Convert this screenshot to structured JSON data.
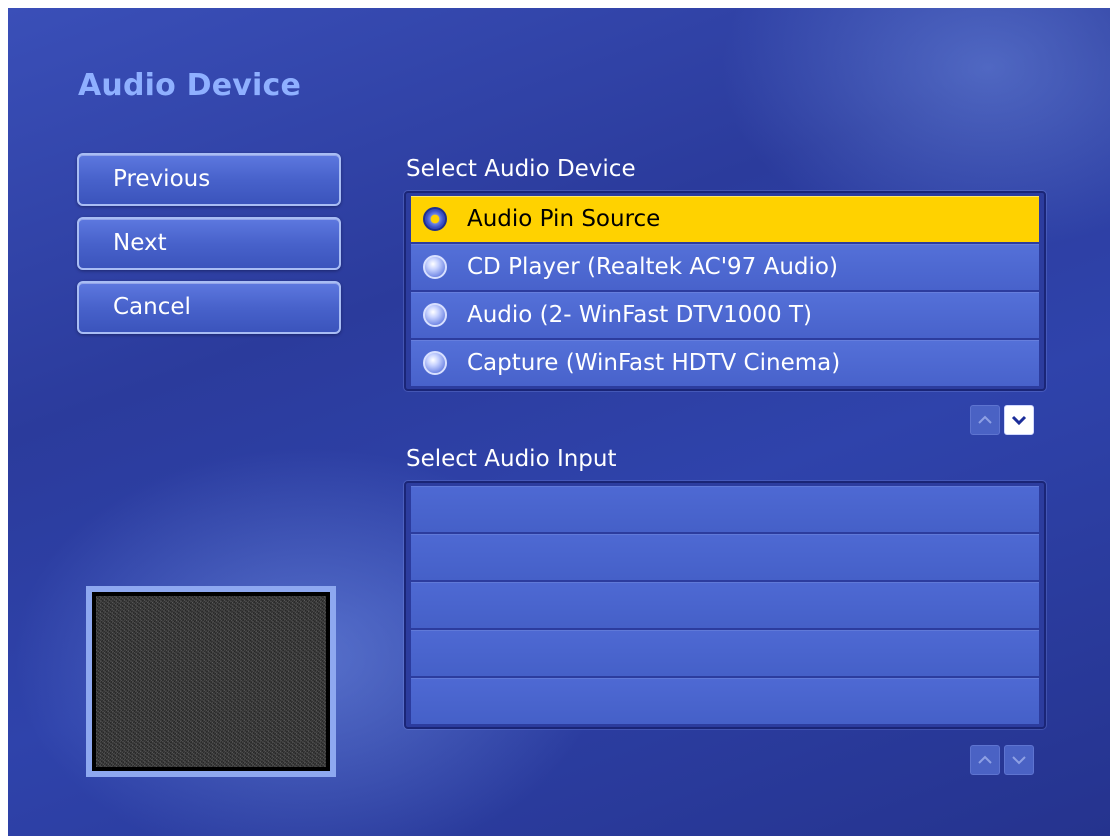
{
  "page": {
    "title": "Audio Device"
  },
  "nav": {
    "previous_label": "Previous",
    "next_label": "Next",
    "cancel_label": "Cancel"
  },
  "device_section": {
    "label": "Select Audio Device",
    "selected_index": 0,
    "items": [
      {
        "label": "Audio Pin Source",
        "selected": true
      },
      {
        "label": "CD Player (Realtek AC'97 Audio)",
        "selected": false
      },
      {
        "label": "Audio (2- WinFast DTV1000 T)",
        "selected": false
      },
      {
        "label": "Capture (WinFast HDTV Cinema)",
        "selected": false
      }
    ],
    "scroll_up_enabled": false,
    "scroll_down_enabled": true
  },
  "input_section": {
    "label": "Select Audio Input",
    "items": [],
    "empty_rows": 5,
    "scroll_up_enabled": false,
    "scroll_down_enabled": false
  },
  "colors": {
    "background": "#2f43ab",
    "title": "#8fb0ff",
    "selection": "#ffd200",
    "row": "#4862cb"
  },
  "icons": {
    "radio": "radio-button-icon",
    "scroll_up": "chevron-up-icon",
    "scroll_down": "chevron-down-icon"
  }
}
